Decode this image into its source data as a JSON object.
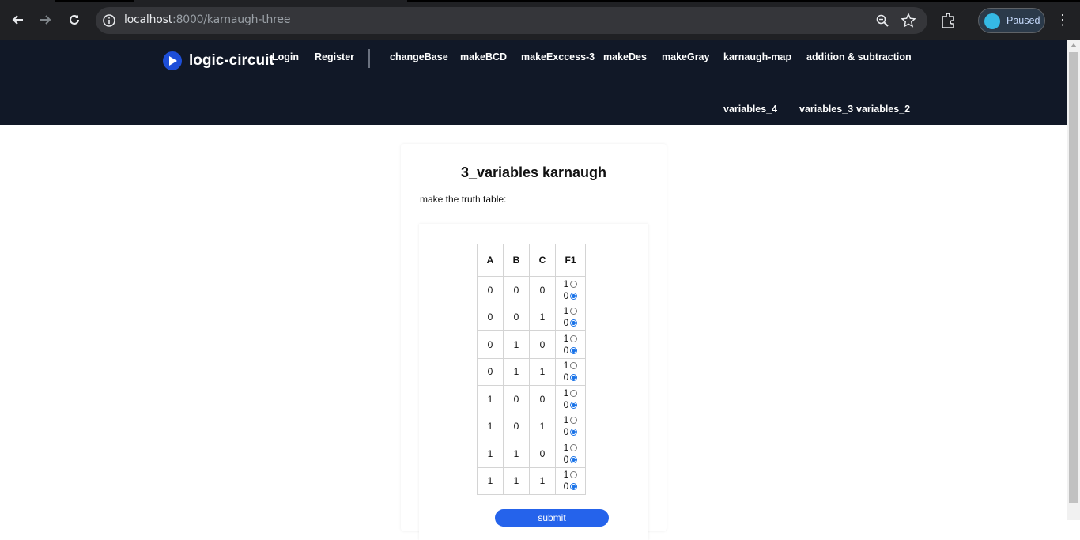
{
  "browser": {
    "url_host": "localhost",
    "url_path": ":8000/karnaugh-three",
    "profile_status": "Paused"
  },
  "header": {
    "brand": "logic-circuit",
    "auth": [
      "Login",
      "Register"
    ],
    "nav": [
      "changeBase",
      "makeBCD",
      "makeExccess-3",
      "makeDes",
      "makeGray",
      "karnaugh-map",
      "addition & subtraction"
    ],
    "subnav": [
      "variables_4",
      "variables_3",
      "variables_2"
    ]
  },
  "page": {
    "title": "3_variables karnaugh",
    "subtitle": "make the truth table:",
    "columns": [
      "A",
      "B",
      "C",
      "F1"
    ],
    "rows": [
      {
        "a": "0",
        "b": "0",
        "c": "0",
        "opt1": "1",
        "opt0": "0",
        "selected": "0"
      },
      {
        "a": "0",
        "b": "0",
        "c": "1",
        "opt1": "1",
        "opt0": "0",
        "selected": "0"
      },
      {
        "a": "0",
        "b": "1",
        "c": "0",
        "opt1": "1",
        "opt0": "0",
        "selected": "0"
      },
      {
        "a": "0",
        "b": "1",
        "c": "1",
        "opt1": "1",
        "opt0": "0",
        "selected": "0"
      },
      {
        "a": "1",
        "b": "0",
        "c": "0",
        "opt1": "1",
        "opt0": "0",
        "selected": "0"
      },
      {
        "a": "1",
        "b": "0",
        "c": "1",
        "opt1": "1",
        "opt0": "0",
        "selected": "0"
      },
      {
        "a": "1",
        "b": "1",
        "c": "0",
        "opt1": "1",
        "opt0": "0",
        "selected": "0"
      },
      {
        "a": "1",
        "b": "1",
        "c": "1",
        "opt1": "1",
        "opt0": "0",
        "selected": "0"
      }
    ],
    "submit_label": "submit"
  },
  "colors": {
    "header_bg": "#111827",
    "accent": "#2563eb",
    "radio_selected": "#1a73e8"
  }
}
